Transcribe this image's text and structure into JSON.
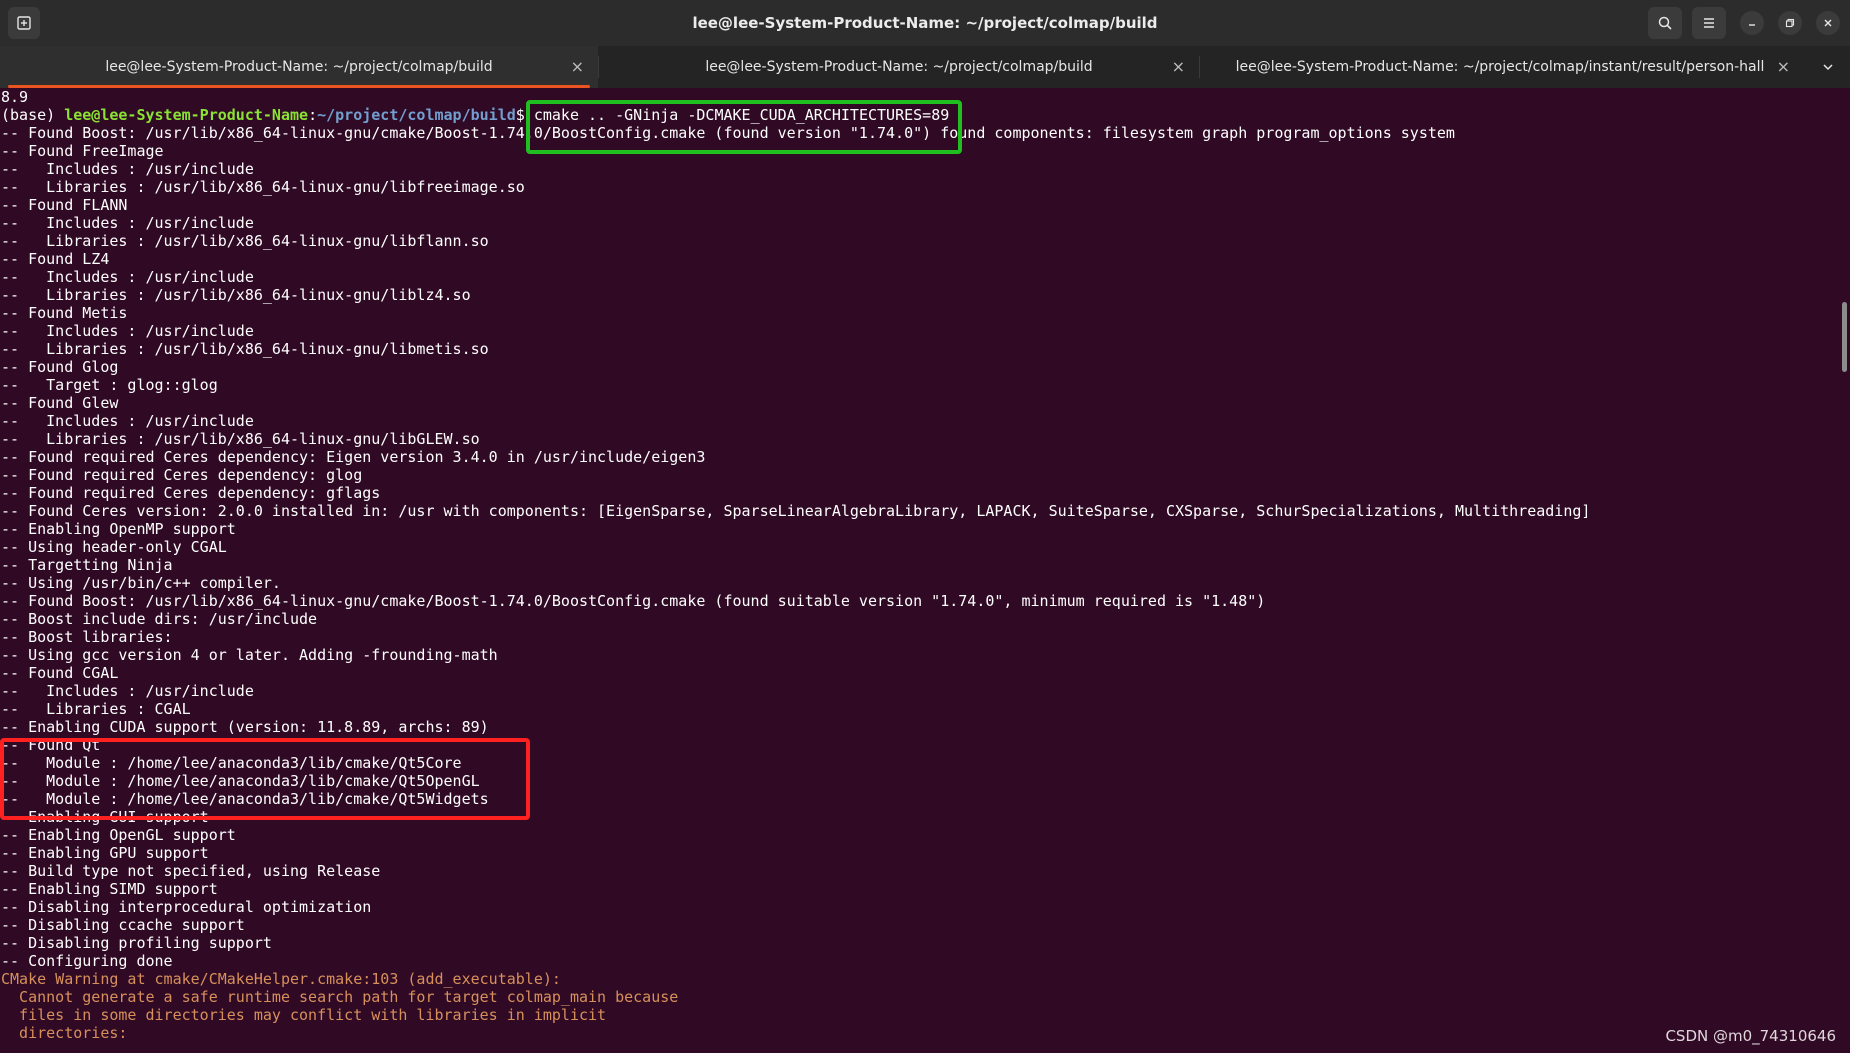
{
  "window": {
    "title": "lee@lee-System-Product-Name: ~/project/colmap/build",
    "icons": {
      "new_tab": "new-tab-icon",
      "search": "search-icon",
      "menu": "hamburger-menu-icon",
      "minimize": "minimize-icon",
      "maximize": "maximize-icon",
      "close": "close-icon"
    }
  },
  "tabs": [
    {
      "label": "lee@lee-System-Product-Name: ~/project/colmap/build",
      "close": "×",
      "active": true
    },
    {
      "label": "lee@lee-System-Product-Name: ~/project/colmap/build",
      "close": "×",
      "active": false
    },
    {
      "label": "lee@lee-System-Product-Name: ~/project/colmap/instant/result/person-hall",
      "close": "×",
      "active": false
    }
  ],
  "colors": {
    "terminal_bg": "#300a24",
    "prompt_user": "#8ae234",
    "prompt_path": "#729fcf",
    "warning_text": "#d7905b",
    "active_tab_accent": "#e95420",
    "highlight_green": "#1fbf1f",
    "highlight_red": "#ff2020"
  },
  "terminal": {
    "first_line": "8.9",
    "prompt": {
      "env": "(base) ",
      "user_host": "lee@lee-System-Product-Name",
      "colon": ":",
      "path": "~/project/colmap/build",
      "symbol": "$ ",
      "command": "cmake .. -GNinja -DCMAKE_CUDA_ARCHITECTURES=89"
    },
    "lines": [
      "-- Found Boost: /usr/lib/x86_64-linux-gnu/cmake/Boost-1.74.0/BoostConfig.cmake (found version \"1.74.0\") found components: filesystem graph program_options system",
      "-- Found FreeImage",
      "--   Includes : /usr/include",
      "--   Libraries : /usr/lib/x86_64-linux-gnu/libfreeimage.so",
      "-- Found FLANN",
      "--   Includes : /usr/include",
      "--   Libraries : /usr/lib/x86_64-linux-gnu/libflann.so",
      "-- Found LZ4",
      "--   Includes : /usr/include",
      "--   Libraries : /usr/lib/x86_64-linux-gnu/liblz4.so",
      "-- Found Metis",
      "--   Includes : /usr/include",
      "--   Libraries : /usr/lib/x86_64-linux-gnu/libmetis.so",
      "-- Found Glog",
      "--   Target : glog::glog",
      "-- Found Glew",
      "--   Includes : /usr/include",
      "--   Libraries : /usr/lib/x86_64-linux-gnu/libGLEW.so",
      "-- Found required Ceres dependency: Eigen version 3.4.0 in /usr/include/eigen3",
      "-- Found required Ceres dependency: glog",
      "-- Found required Ceres dependency: gflags",
      "-- Found Ceres version: 2.0.0 installed in: /usr with components: [EigenSparse, SparseLinearAlgebraLibrary, LAPACK, SuiteSparse, CXSparse, SchurSpecializations, Multithreading]",
      "-- Enabling OpenMP support",
      "-- Using header-only CGAL",
      "-- Targetting Ninja",
      "-- Using /usr/bin/c++ compiler.",
      "-- Found Boost: /usr/lib/x86_64-linux-gnu/cmake/Boost-1.74.0/BoostConfig.cmake (found suitable version \"1.74.0\", minimum required is \"1.48\")",
      "-- Boost include dirs: /usr/include",
      "-- Boost libraries:",
      "-- Using gcc version 4 or later. Adding -frounding-math",
      "-- Found CGAL",
      "--   Includes : /usr/include",
      "--   Libraries : CGAL",
      "-- Enabling CUDA support (version: 11.8.89, archs: 89)",
      "-- Found Qt",
      "--   Module : /home/lee/anaconda3/lib/cmake/Qt5Core",
      "--   Module : /home/lee/anaconda3/lib/cmake/Qt5OpenGL",
      "--   Module : /home/lee/anaconda3/lib/cmake/Qt5Widgets",
      "-- Enabling GUI support",
      "-- Enabling OpenGL support",
      "-- Enabling GPU support",
      "-- Build type not specified, using Release",
      "-- Enabling SIMD support",
      "-- Disabling interprocedural optimization",
      "-- Disabling ccache support",
      "-- Disabling profiling support",
      "-- Configuring done"
    ],
    "warning_lines": [
      "CMake Warning at cmake/CMakeHelper.cmake:103 (add_executable):",
      "  Cannot generate a safe runtime search path for target colmap_main because",
      "  files in some directories may conflict with libraries in implicit",
      "  directories:"
    ]
  },
  "watermark": "CSDN @m0_74310646"
}
